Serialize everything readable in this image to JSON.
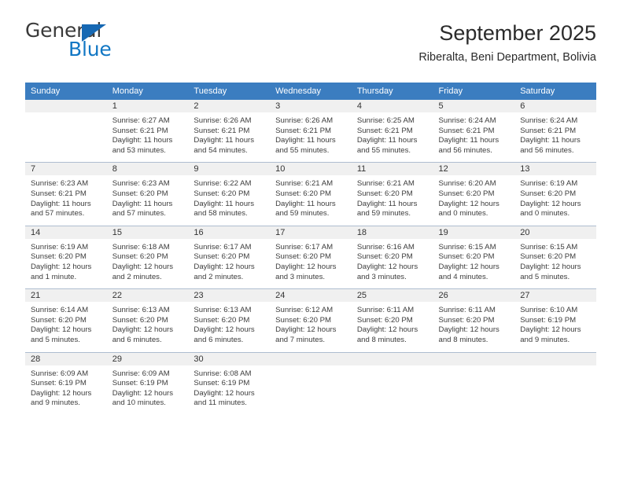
{
  "brand": {
    "name_primary": "General",
    "name_secondary": "Blue",
    "triangle_icon": "triangle-icon",
    "primary_color": "#3a3a3a",
    "secondary_color": "#1277c4",
    "triangle_color": "#1668b3"
  },
  "header": {
    "title": "September 2025",
    "subtitle": "Riberalta, Beni Department, Bolivia"
  },
  "calendar": {
    "header_bg": "#3b7dc0",
    "daynum_bg": "#f0f0f0",
    "weekday_headers": [
      "Sunday",
      "Monday",
      "Tuesday",
      "Wednesday",
      "Thursday",
      "Friday",
      "Saturday"
    ],
    "weeks": [
      [
        {
          "day": "",
          "lines": []
        },
        {
          "day": "1",
          "lines": [
            "Sunrise: 6:27 AM",
            "Sunset: 6:21 PM",
            "Daylight: 11 hours",
            "and 53 minutes."
          ]
        },
        {
          "day": "2",
          "lines": [
            "Sunrise: 6:26 AM",
            "Sunset: 6:21 PM",
            "Daylight: 11 hours",
            "and 54 minutes."
          ]
        },
        {
          "day": "3",
          "lines": [
            "Sunrise: 6:26 AM",
            "Sunset: 6:21 PM",
            "Daylight: 11 hours",
            "and 55 minutes."
          ]
        },
        {
          "day": "4",
          "lines": [
            "Sunrise: 6:25 AM",
            "Sunset: 6:21 PM",
            "Daylight: 11 hours",
            "and 55 minutes."
          ]
        },
        {
          "day": "5",
          "lines": [
            "Sunrise: 6:24 AM",
            "Sunset: 6:21 PM",
            "Daylight: 11 hours",
            "and 56 minutes."
          ]
        },
        {
          "day": "6",
          "lines": [
            "Sunrise: 6:24 AM",
            "Sunset: 6:21 PM",
            "Daylight: 11 hours",
            "and 56 minutes."
          ]
        }
      ],
      [
        {
          "day": "7",
          "lines": [
            "Sunrise: 6:23 AM",
            "Sunset: 6:21 PM",
            "Daylight: 11 hours",
            "and 57 minutes."
          ]
        },
        {
          "day": "8",
          "lines": [
            "Sunrise: 6:23 AM",
            "Sunset: 6:20 PM",
            "Daylight: 11 hours",
            "and 57 minutes."
          ]
        },
        {
          "day": "9",
          "lines": [
            "Sunrise: 6:22 AM",
            "Sunset: 6:20 PM",
            "Daylight: 11 hours",
            "and 58 minutes."
          ]
        },
        {
          "day": "10",
          "lines": [
            "Sunrise: 6:21 AM",
            "Sunset: 6:20 PM",
            "Daylight: 11 hours",
            "and 59 minutes."
          ]
        },
        {
          "day": "11",
          "lines": [
            "Sunrise: 6:21 AM",
            "Sunset: 6:20 PM",
            "Daylight: 11 hours",
            "and 59 minutes."
          ]
        },
        {
          "day": "12",
          "lines": [
            "Sunrise: 6:20 AM",
            "Sunset: 6:20 PM",
            "Daylight: 12 hours",
            "and 0 minutes."
          ]
        },
        {
          "day": "13",
          "lines": [
            "Sunrise: 6:19 AM",
            "Sunset: 6:20 PM",
            "Daylight: 12 hours",
            "and 0 minutes."
          ]
        }
      ],
      [
        {
          "day": "14",
          "lines": [
            "Sunrise: 6:19 AM",
            "Sunset: 6:20 PM",
            "Daylight: 12 hours",
            "and 1 minute."
          ]
        },
        {
          "day": "15",
          "lines": [
            "Sunrise: 6:18 AM",
            "Sunset: 6:20 PM",
            "Daylight: 12 hours",
            "and 2 minutes."
          ]
        },
        {
          "day": "16",
          "lines": [
            "Sunrise: 6:17 AM",
            "Sunset: 6:20 PM",
            "Daylight: 12 hours",
            "and 2 minutes."
          ]
        },
        {
          "day": "17",
          "lines": [
            "Sunrise: 6:17 AM",
            "Sunset: 6:20 PM",
            "Daylight: 12 hours",
            "and 3 minutes."
          ]
        },
        {
          "day": "18",
          "lines": [
            "Sunrise: 6:16 AM",
            "Sunset: 6:20 PM",
            "Daylight: 12 hours",
            "and 3 minutes."
          ]
        },
        {
          "day": "19",
          "lines": [
            "Sunrise: 6:15 AM",
            "Sunset: 6:20 PM",
            "Daylight: 12 hours",
            "and 4 minutes."
          ]
        },
        {
          "day": "20",
          "lines": [
            "Sunrise: 6:15 AM",
            "Sunset: 6:20 PM",
            "Daylight: 12 hours",
            "and 5 minutes."
          ]
        }
      ],
      [
        {
          "day": "21",
          "lines": [
            "Sunrise: 6:14 AM",
            "Sunset: 6:20 PM",
            "Daylight: 12 hours",
            "and 5 minutes."
          ]
        },
        {
          "day": "22",
          "lines": [
            "Sunrise: 6:13 AM",
            "Sunset: 6:20 PM",
            "Daylight: 12 hours",
            "and 6 minutes."
          ]
        },
        {
          "day": "23",
          "lines": [
            "Sunrise: 6:13 AM",
            "Sunset: 6:20 PM",
            "Daylight: 12 hours",
            "and 6 minutes."
          ]
        },
        {
          "day": "24",
          "lines": [
            "Sunrise: 6:12 AM",
            "Sunset: 6:20 PM",
            "Daylight: 12 hours",
            "and 7 minutes."
          ]
        },
        {
          "day": "25",
          "lines": [
            "Sunrise: 6:11 AM",
            "Sunset: 6:20 PM",
            "Daylight: 12 hours",
            "and 8 minutes."
          ]
        },
        {
          "day": "26",
          "lines": [
            "Sunrise: 6:11 AM",
            "Sunset: 6:20 PM",
            "Daylight: 12 hours",
            "and 8 minutes."
          ]
        },
        {
          "day": "27",
          "lines": [
            "Sunrise: 6:10 AM",
            "Sunset: 6:19 PM",
            "Daylight: 12 hours",
            "and 9 minutes."
          ]
        }
      ],
      [
        {
          "day": "28",
          "lines": [
            "Sunrise: 6:09 AM",
            "Sunset: 6:19 PM",
            "Daylight: 12 hours",
            "and 9 minutes."
          ]
        },
        {
          "day": "29",
          "lines": [
            "Sunrise: 6:09 AM",
            "Sunset: 6:19 PM",
            "Daylight: 12 hours",
            "and 10 minutes."
          ]
        },
        {
          "day": "30",
          "lines": [
            "Sunrise: 6:08 AM",
            "Sunset: 6:19 PM",
            "Daylight: 12 hours",
            "and 11 minutes."
          ]
        },
        {
          "day": "",
          "lines": []
        },
        {
          "day": "",
          "lines": []
        },
        {
          "day": "",
          "lines": []
        },
        {
          "day": "",
          "lines": []
        }
      ]
    ]
  }
}
